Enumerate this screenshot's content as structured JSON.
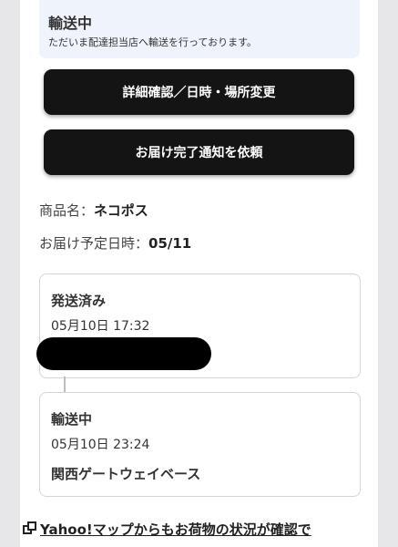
{
  "notice": {
    "title": "輸送中",
    "text": "ただいま配達担当店へ輸送を行っております。"
  },
  "buttons": {
    "detail_label": "詳細確認／日時・場所変更",
    "notify_label": "お届け完了通知を依頼"
  },
  "product": {
    "label": "商品名：",
    "value": "ネコポス"
  },
  "delivery": {
    "label": "お届け予定日時：",
    "value": "05/11"
  },
  "timeline": [
    {
      "status": "発送済み",
      "time": "05月10日 17:32",
      "place": ""
    },
    {
      "status": "輸送中",
      "time": "05月10日 23:24",
      "place": "関西ゲートウェイベース"
    }
  ],
  "map_link": {
    "icon": "copy-icon",
    "text": "Yahoo!マップからもお荷物の状況が確認で"
  },
  "colors": {
    "button_bg": "#141414",
    "notice_bg": "#eef3fc",
    "page_bg": "#e7e7ea"
  }
}
